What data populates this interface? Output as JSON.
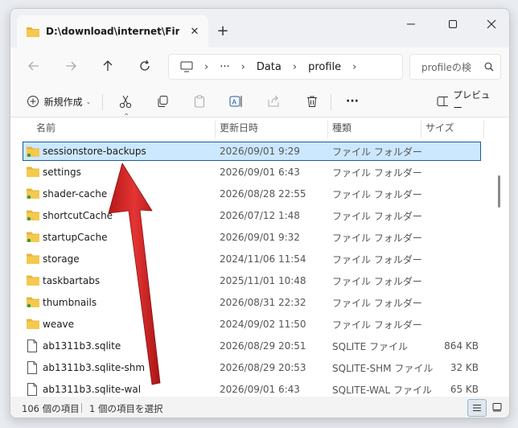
{
  "tab": {
    "title": "D:\\download\\internet\\Firefox"
  },
  "breadcrumb": {
    "more": "···",
    "items": [
      "Data",
      "profile"
    ]
  },
  "search": {
    "placeholder": "profileの検"
  },
  "toolbar": {
    "new_label": "新規作成",
    "more": "···",
    "preview_label": "プレビュー"
  },
  "columns": {
    "name": "名前",
    "date": "更新日時",
    "type": "種類",
    "size": "サイズ"
  },
  "files": [
    {
      "name": "sessionstore-backups",
      "date": "2026/09/01 9:29",
      "type": "ファイル フォルダー",
      "size": "",
      "kind": "folder-green",
      "selected": true
    },
    {
      "name": "settings",
      "date": "2026/09/01 6:43",
      "type": "ファイル フォルダー",
      "size": "",
      "kind": "folder"
    },
    {
      "name": "shader-cache",
      "date": "2026/08/28 22:55",
      "type": "ファイル フォルダー",
      "size": "",
      "kind": "folder-green"
    },
    {
      "name": "shortcutCache",
      "date": "2026/07/12 1:48",
      "type": "ファイル フォルダー",
      "size": "",
      "kind": "folder-green"
    },
    {
      "name": "startupCache",
      "date": "2026/09/01 9:32",
      "type": "ファイル フォルダー",
      "size": "",
      "kind": "folder-green"
    },
    {
      "name": "storage",
      "date": "2024/11/06 11:54",
      "type": "ファイル フォルダー",
      "size": "",
      "kind": "folder"
    },
    {
      "name": "taskbartabs",
      "date": "2025/11/01 10:48",
      "type": "ファイル フォルダー",
      "size": "",
      "kind": "folder"
    },
    {
      "name": "thumbnails",
      "date": "2026/08/31 22:32",
      "type": "ファイル フォルダー",
      "size": "",
      "kind": "folder-green"
    },
    {
      "name": "weave",
      "date": "2024/09/02 11:50",
      "type": "ファイル フォルダー",
      "size": "",
      "kind": "folder"
    },
    {
      "name": "ab1311b3.sqlite",
      "date": "2026/08/29 20:51",
      "type": "SQLITE ファイル",
      "size": "864 KB",
      "kind": "file"
    },
    {
      "name": "ab1311b3.sqlite-shm",
      "date": "2026/08/29 20:53",
      "type": "SQLITE-SHM ファイル",
      "size": "32 KB",
      "kind": "file"
    },
    {
      "name": "ab1311b3.sqlite-wal",
      "date": "2026/09/01 6:43",
      "type": "SQLITE-WAL ファイル",
      "size": "65 KB",
      "kind": "file"
    }
  ],
  "status": {
    "count": "106 個の項目",
    "selected": "1 個の項目を選択"
  },
  "colors": {
    "folder": "#f2c14e",
    "selection": "#cce8ff",
    "arrow": "#d32020"
  }
}
